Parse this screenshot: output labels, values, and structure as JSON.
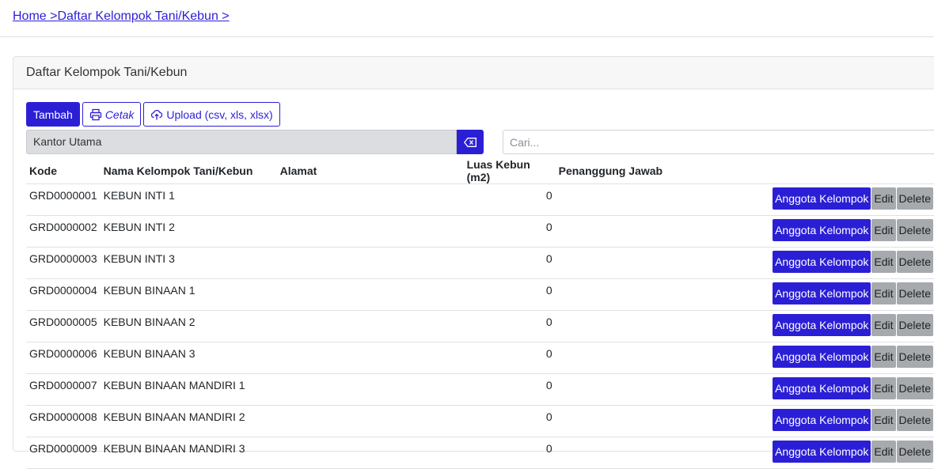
{
  "breadcrumb": {
    "home": "Home >",
    "current": "Daftar Kelompok Tani/Kebun >"
  },
  "card": {
    "title": "Daftar Kelompok Tani/Kebun"
  },
  "toolbar": {
    "add_label": "Tambah",
    "print_label": "Cetak",
    "upload_label": "Upload (csv, xls, xlsx)"
  },
  "filter": {
    "office_value": "Kantor Utama"
  },
  "search": {
    "placeholder": "Cari..."
  },
  "table": {
    "headers": {
      "kode": "Kode",
      "nama": "Nama Kelompok Tani/Kebun",
      "alamat": "Alamat",
      "luas": "Luas Kebun (m2)",
      "pj": "Penanggung Jawab"
    },
    "actions": {
      "anggota": "Anggota Kelompok",
      "edit": "Edit",
      "delete": "Delete"
    },
    "rows": [
      {
        "kode": "GRD0000001",
        "nama": "KEBUN INTI 1",
        "alamat": "",
        "luas": "0",
        "pj": ""
      },
      {
        "kode": "GRD0000002",
        "nama": "KEBUN INTI 2",
        "alamat": "",
        "luas": "0",
        "pj": ""
      },
      {
        "kode": "GRD0000003",
        "nama": "KEBUN INTI 3",
        "alamat": "",
        "luas": "0",
        "pj": ""
      },
      {
        "kode": "GRD0000004",
        "nama": "KEBUN BINAAN 1",
        "alamat": "",
        "luas": "0",
        "pj": ""
      },
      {
        "kode": "GRD0000005",
        "nama": "KEBUN BINAAN 2",
        "alamat": "",
        "luas": "0",
        "pj": ""
      },
      {
        "kode": "GRD0000006",
        "nama": "KEBUN BINAAN 3",
        "alamat": "",
        "luas": "0",
        "pj": ""
      },
      {
        "kode": "GRD0000007",
        "nama": "KEBUN BINAAN MANDIRI 1",
        "alamat": "",
        "luas": "0",
        "pj": ""
      },
      {
        "kode": "GRD0000008",
        "nama": "KEBUN BINAAN MANDIRI 2",
        "alamat": "",
        "luas": "0",
        "pj": ""
      },
      {
        "kode": "GRD0000009",
        "nama": "KEBUN BINAAN MANDIRI 3",
        "alamat": "",
        "luas": "0",
        "pj": ""
      }
    ]
  },
  "colors": {
    "primary": "#2b1fd6",
    "action_gray": "#a6a9ad"
  },
  "icons": {
    "print": "printer-icon",
    "upload": "cloud-upload-icon",
    "clear": "backspace-icon"
  }
}
